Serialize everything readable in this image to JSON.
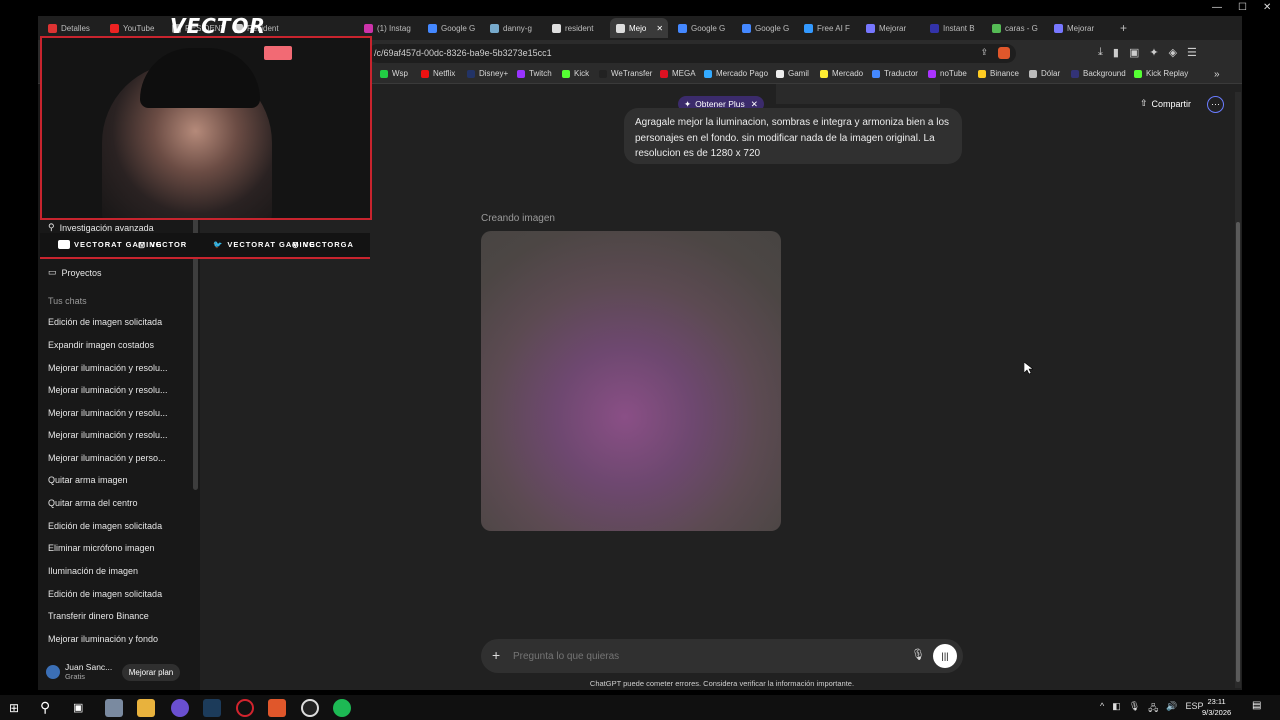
{
  "window": {
    "controls": [
      "—",
      "☐",
      "✕"
    ]
  },
  "tabs": [
    {
      "label": "Detalles",
      "color": "#d33"
    },
    {
      "label": "YouTube",
      "color": "#e22"
    },
    {
      "label": "RESIDENT",
      "color": "#999"
    },
    {
      "label": "Resident",
      "color": "#ccc"
    },
    {
      "label": "(1) Instag",
      "color": "#c3a"
    },
    {
      "label": "Google G",
      "color": "#48f"
    },
    {
      "label": "danny-g",
      "color": "#7ac"
    },
    {
      "label": "resident",
      "color": "#ddd"
    },
    {
      "label": "Mejo",
      "color": "#ddd"
    },
    {
      "label": "Google G",
      "color": "#48f"
    },
    {
      "label": "Google G",
      "color": "#48f"
    },
    {
      "label": "Free AI F",
      "color": "#39f"
    },
    {
      "label": "Mejorar",
      "color": "#77f"
    },
    {
      "label": "Instant B",
      "color": "#33a"
    },
    {
      "label": "caras - G",
      "color": "#5b5"
    },
    {
      "label": "Mejorar",
      "color": "#77f"
    }
  ],
  "url": "/c/69af457d-00dc-8326-ba9e-5b3273e15cc1",
  "bookmarks": [
    {
      "label": "Wsp",
      "color": "#2c4"
    },
    {
      "label": "Netflix",
      "color": "#e11"
    },
    {
      "label": "Disney+",
      "color": "#236"
    },
    {
      "label": "Twitch",
      "color": "#93f"
    },
    {
      "label": "Kick",
      "color": "#5f3"
    },
    {
      "label": "WeTransfer",
      "color": "#222"
    },
    {
      "label": "MEGA",
      "color": "#d12"
    },
    {
      "label": "Mercado Pago",
      "color": "#3af"
    },
    {
      "label": "Gamil",
      "color": "#eee"
    },
    {
      "label": "Mercado",
      "color": "#fe3"
    },
    {
      "label": "Traductor",
      "color": "#48f"
    },
    {
      "label": "noTube",
      "color": "#a3f"
    },
    {
      "label": "Binance",
      "color": "#fc2"
    },
    {
      "label": "Dólar",
      "color": "#bbb"
    },
    {
      "label": "Background",
      "color": "#337"
    },
    {
      "label": "Kick Replay",
      "color": "#5f3"
    }
  ],
  "sidebar": {
    "advanced": "Investigación avanzada",
    "projects": "Proyectos",
    "chats_heading": "Tus chats",
    "chats": [
      "Edición de imagen solicitada",
      "Expandir imagen costados",
      "Mejorar iluminación y resolu...",
      "Mejorar iluminación y resolu...",
      "Mejorar iluminación y resolu...",
      "Mejorar iluminación y resolu...",
      "Mejorar iluminación y perso...",
      "Quitar arma imagen",
      "Quitar arma del centro",
      "Edición de imagen solicitada",
      "Eliminar micrófono imagen",
      "Iluminación de imagen",
      "Edición de imagen solicitada",
      "Transferir dinero Binance",
      "Mejorar iluminación y fondo"
    ],
    "user_name": "Juan Sanc...",
    "user_plan": "Gratis",
    "upgrade": "Mejorar plan"
  },
  "header": {
    "obtener": "Obtener Plus",
    "share": "Compartir"
  },
  "message": "Agragale mejor la iluminacion, sombras e integra y armoniza bien a los personajes en el fondo. sin modificar nada de la imagen original. La resolucion es de 1280 x 720",
  "creating": "Creando imagen",
  "composer": {
    "placeholder": "Pregunta lo que quieras"
  },
  "disclaimer": "ChatGPT puede cometer errores. Considera verificar la información importante.",
  "overlay": {
    "logo": "VECTOR",
    "social": [
      "VECTORAT GAMING",
      "VECTOR",
      "VECTORAT GAMING",
      "VECTORGA"
    ]
  },
  "taskbar": {
    "lang": "ESP",
    "time": "23:11",
    "date": "9/3/2026"
  }
}
